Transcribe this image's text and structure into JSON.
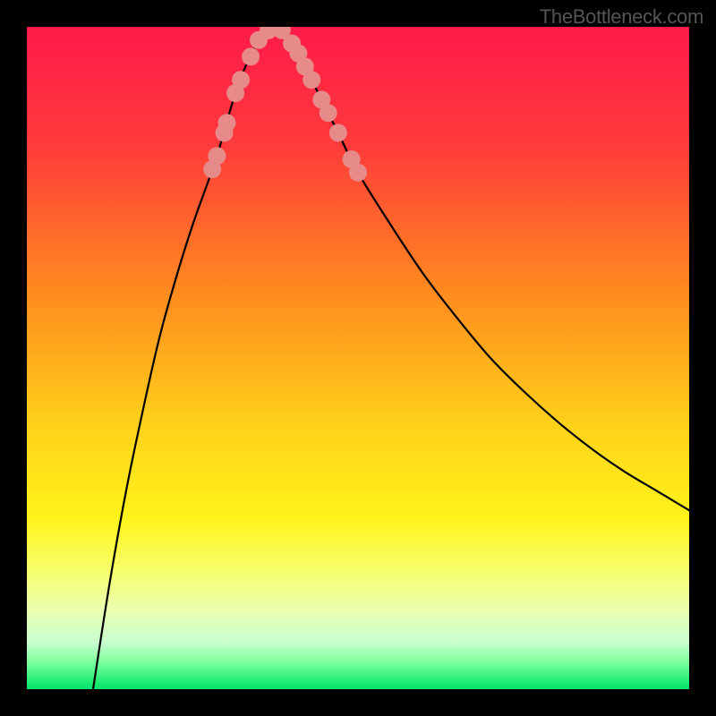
{
  "watermark": "TheBottleneck.com",
  "chart_data": {
    "type": "line",
    "title": "",
    "xlabel": "",
    "ylabel": "",
    "xlim": [
      0,
      100
    ],
    "ylim": [
      0,
      100
    ],
    "grid": false,
    "legend": false,
    "gradient_stops": [
      {
        "offset": 0,
        "color": "#ff1a4a"
      },
      {
        "offset": 18,
        "color": "#ff3b3b"
      },
      {
        "offset": 40,
        "color": "#ff8a1f"
      },
      {
        "offset": 60,
        "color": "#ffd11a"
      },
      {
        "offset": 74,
        "color": "#fff31a"
      },
      {
        "offset": 82,
        "color": "#f7ff6a"
      },
      {
        "offset": 88,
        "color": "#eaffb0"
      },
      {
        "offset": 93,
        "color": "#c8ffd0"
      },
      {
        "offset": 96,
        "color": "#7aff9a"
      },
      {
        "offset": 100,
        "color": "#00e56a"
      }
    ],
    "series": [
      {
        "name": "left-curve",
        "type": "line",
        "color": "#000000",
        "points": [
          {
            "x": 10.0,
            "y": 0.0
          },
          {
            "x": 12.5,
            "y": 16.0
          },
          {
            "x": 15.0,
            "y": 30.0
          },
          {
            "x": 17.5,
            "y": 42.0
          },
          {
            "x": 20.0,
            "y": 53.0
          },
          {
            "x": 22.5,
            "y": 62.0
          },
          {
            "x": 25.0,
            "y": 70.0
          },
          {
            "x": 27.5,
            "y": 77.0
          },
          {
            "x": 29.0,
            "y": 81.5
          },
          {
            "x": 30.0,
            "y": 85.0
          },
          {
            "x": 31.5,
            "y": 90.0
          },
          {
            "x": 33.0,
            "y": 94.0
          },
          {
            "x": 34.5,
            "y": 97.0
          },
          {
            "x": 36.0,
            "y": 99.0
          },
          {
            "x": 37.5,
            "y": 100.0
          }
        ]
      },
      {
        "name": "right-curve",
        "type": "line",
        "color": "#000000",
        "points": [
          {
            "x": 37.5,
            "y": 100.0
          },
          {
            "x": 39.0,
            "y": 99.0
          },
          {
            "x": 40.5,
            "y": 97.0
          },
          {
            "x": 42.0,
            "y": 94.0
          },
          {
            "x": 44.0,
            "y": 90.0
          },
          {
            "x": 47.0,
            "y": 84.0
          },
          {
            "x": 50.0,
            "y": 78.0
          },
          {
            "x": 55.0,
            "y": 70.0
          },
          {
            "x": 60.0,
            "y": 62.5
          },
          {
            "x": 65.0,
            "y": 56.0
          },
          {
            "x": 70.0,
            "y": 50.0
          },
          {
            "x": 75.0,
            "y": 45.0
          },
          {
            "x": 80.0,
            "y": 40.5
          },
          {
            "x": 85.0,
            "y": 36.5
          },
          {
            "x": 90.0,
            "y": 33.0
          },
          {
            "x": 95.0,
            "y": 30.0
          },
          {
            "x": 100.0,
            "y": 27.0
          }
        ]
      },
      {
        "name": "left-dots",
        "type": "scatter",
        "color": "#e68a8a",
        "radius": 10,
        "points": [
          {
            "x": 28.0,
            "y": 78.5
          },
          {
            "x": 28.7,
            "y": 80.5
          },
          {
            "x": 29.8,
            "y": 84.0
          },
          {
            "x": 30.2,
            "y": 85.5
          },
          {
            "x": 31.5,
            "y": 90.0
          },
          {
            "x": 32.3,
            "y": 92.0
          },
          {
            "x": 33.8,
            "y": 95.5
          },
          {
            "x": 35.0,
            "y": 98.0
          },
          {
            "x": 36.5,
            "y": 99.5
          }
        ]
      },
      {
        "name": "right-dots",
        "type": "scatter",
        "color": "#e68a8a",
        "radius": 10,
        "points": [
          {
            "x": 38.5,
            "y": 99.5
          },
          {
            "x": 40.0,
            "y": 97.5
          },
          {
            "x": 41.0,
            "y": 96.0
          },
          {
            "x": 42.0,
            "y": 94.0
          },
          {
            "x": 43.0,
            "y": 92.0
          },
          {
            "x": 44.5,
            "y": 89.0
          },
          {
            "x": 45.5,
            "y": 87.0
          },
          {
            "x": 47.0,
            "y": 84.0
          },
          {
            "x": 49.0,
            "y": 80.0
          },
          {
            "x": 50.0,
            "y": 78.0
          }
        ]
      }
    ]
  }
}
